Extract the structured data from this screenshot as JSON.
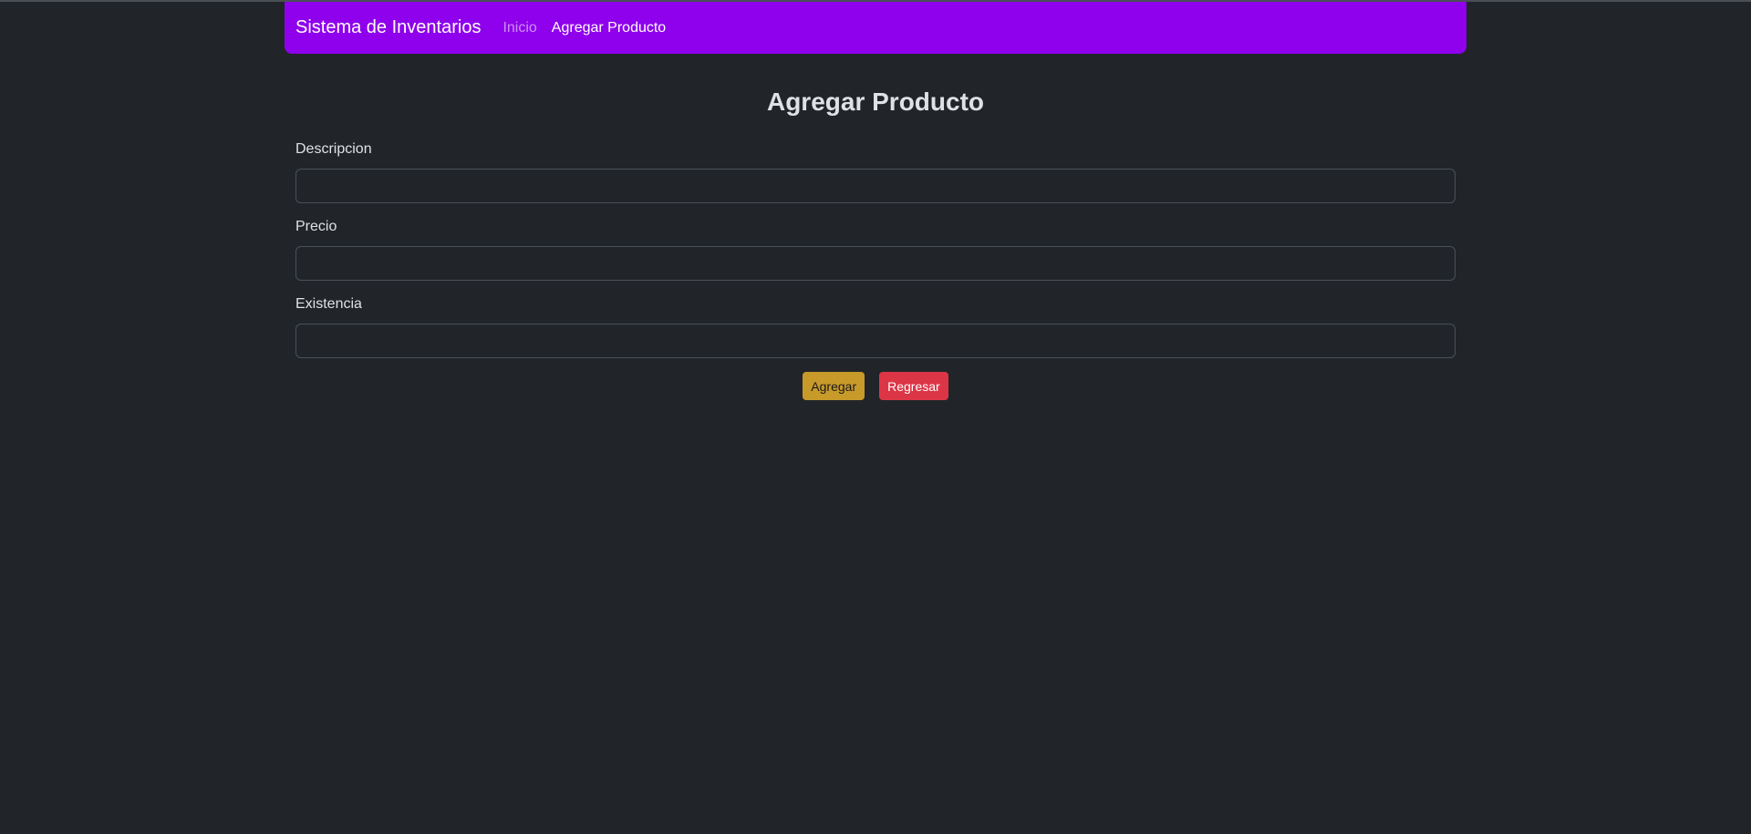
{
  "navbar": {
    "brand": "Sistema de Inventarios",
    "links": [
      {
        "label": "Inicio"
      },
      {
        "label": "Agregar Producto"
      }
    ]
  },
  "page": {
    "title": "Agregar Producto"
  },
  "form": {
    "fields": [
      {
        "label": "Descripcion",
        "value": ""
      },
      {
        "label": "Precio",
        "value": ""
      },
      {
        "label": "Existencia",
        "value": ""
      }
    ],
    "submit_label": "Agregar",
    "back_label": "Regresar"
  },
  "colors": {
    "navbar": "#8f00ec",
    "background": "#212529",
    "warning": "#c89a2a",
    "danger": "#dc3545"
  }
}
